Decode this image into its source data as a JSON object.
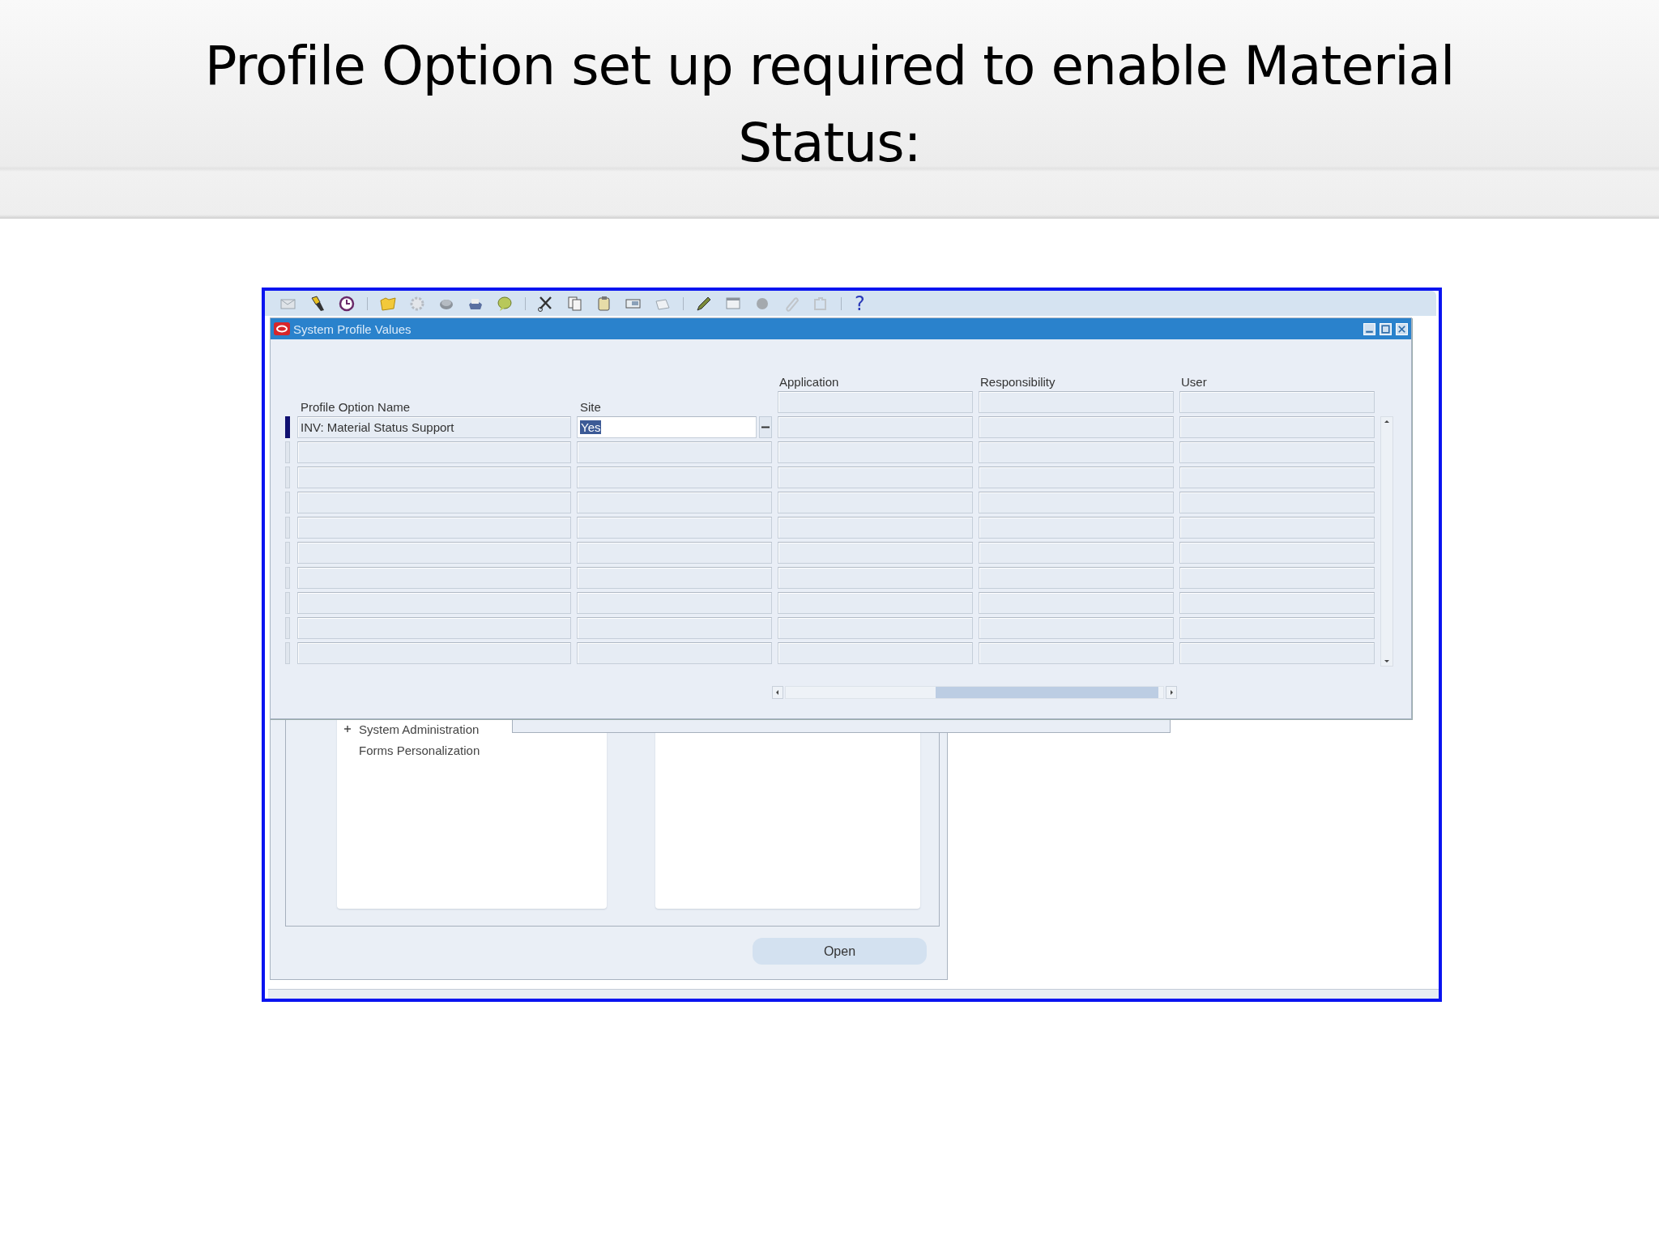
{
  "slide_title": "Profile Option set up required to enable Material Status:",
  "toolbar": {
    "help": "?"
  },
  "window": {
    "title": "System Profile Values"
  },
  "columns": [
    {
      "label": "Profile Option Name"
    },
    {
      "label": "Site"
    },
    {
      "label": "Application"
    },
    {
      "label": "Responsibility"
    },
    {
      "label": "User"
    }
  ],
  "rows": [
    {
      "profile_option_name": "INV: Material Status Support",
      "site": "Yes",
      "selected": true
    },
    {
      "selected": false
    },
    {
      "selected": false
    },
    {
      "selected": false
    },
    {
      "selected": false
    },
    {
      "selected": false
    },
    {
      "selected": false
    },
    {
      "selected": false
    },
    {
      "selected": false
    },
    {
      "selected": false
    }
  ],
  "navigator": {
    "items": [
      {
        "label": "System Administration",
        "kind": "folder",
        "expanded": false
      },
      {
        "label": "Forms Personalization",
        "kind": "function"
      }
    ],
    "open_button": "Open"
  }
}
